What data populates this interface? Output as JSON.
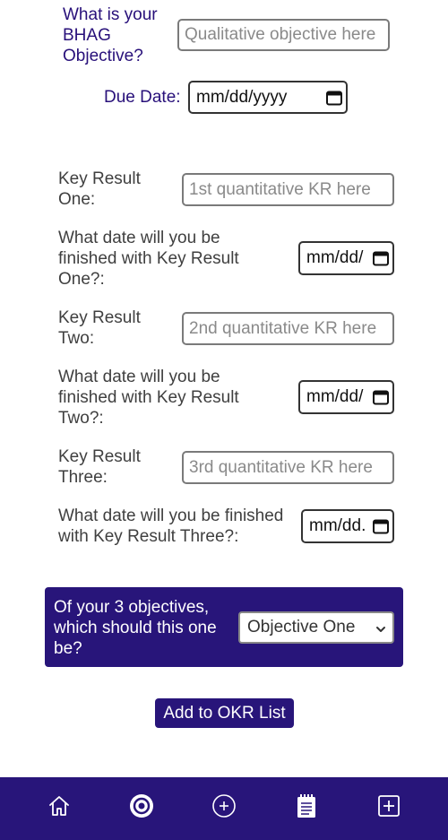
{
  "objective": {
    "label": "What is your BHAG Objective?",
    "placeholder": "Qualitative objective here"
  },
  "due_date": {
    "label": "Due Date:",
    "placeholder": "mm/dd/yyyy"
  },
  "key_results": [
    {
      "label": "Key Result One:",
      "placeholder": "1st quantitative KR here",
      "date_label": "What date will you be finished with Key Result One?:",
      "date_placeholder": "mm/dd/"
    },
    {
      "label": "Key Result Two:",
      "placeholder": "2nd quantitative KR here",
      "date_label": "What date will you be finished with Key Result Two?:",
      "date_placeholder": "mm/dd/"
    },
    {
      "label": "Key Result Three:",
      "placeholder": "3rd quantitative KR here",
      "date_label": "What date will you be finished with Key Result Three?:",
      "date_placeholder": "mm/dd."
    }
  ],
  "which_objective": {
    "label": "Of your 3 objectives, which should this one be?",
    "selected": "Objective One"
  },
  "add_button_label": "Add to OKR List",
  "navbar": {
    "items": [
      {
        "icon": "home-icon"
      },
      {
        "icon": "target-icon",
        "active": true
      },
      {
        "icon": "plus-circle-icon"
      },
      {
        "icon": "notepad-icon"
      },
      {
        "icon": "plus-square-icon"
      }
    ]
  },
  "colors": {
    "accent": "#28157a",
    "label_text": "#3f3f3f",
    "input_border": "#7a7a7a"
  }
}
